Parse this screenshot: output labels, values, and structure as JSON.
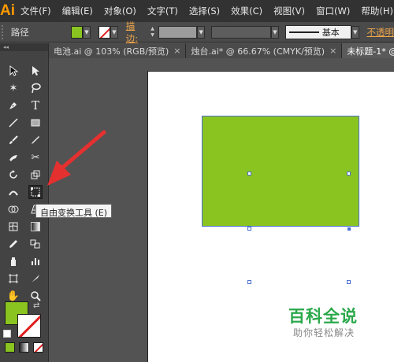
{
  "app": {
    "logo": "Ai"
  },
  "menu": [
    "文件(F)",
    "编辑(E)",
    "对象(O)",
    "文字(T)",
    "选择(S)",
    "效果(C)",
    "视图(V)",
    "窗口(W)",
    "帮助(H)"
  ],
  "control_bar": {
    "path_label": "路径",
    "fill_color": "#8ac420",
    "stroke_label": "描边:",
    "profile_label": "基本",
    "opacity_label": "不透明"
  },
  "tabs": [
    {
      "label": "电池.ai @ 103% (RGB/预览)",
      "close": "×",
      "active": false
    },
    {
      "label": "烛台.ai* @ 66.67% (CMYK/预览)",
      "close": "×",
      "active": false
    },
    {
      "label": "未标题-1* @ 9",
      "close": "",
      "active": true
    }
  ],
  "tooltip": {
    "text": "自由变换工具 (E)"
  },
  "tools": {
    "active": "free-transform-icon",
    "rows": [
      [
        "selection-arrow-icon",
        "direct-selection-icon"
      ],
      [
        "magic-wand-icon",
        "lasso-icon"
      ],
      [
        "pen-icon",
        "type-icon"
      ],
      [
        "line-segment-icon",
        "rectangle-icon"
      ],
      [
        "paintbrush-icon",
        "pencil-icon"
      ],
      [
        "blob-brush-icon",
        "scissors-icon"
      ],
      [
        "rotate-icon",
        "scale-icon"
      ],
      [
        "width-tool-icon",
        "free-transform-icon"
      ],
      [
        "shape-builder-icon",
        "perspective-grid-icon"
      ],
      [
        "mesh-icon",
        "gradient-icon"
      ],
      [
        "eyedropper-icon",
        "blend-icon"
      ],
      [
        "symbol-sprayer-icon",
        "column-graph-icon"
      ],
      [
        "artboard-icon",
        "slice-icon"
      ],
      [
        "hand-icon",
        "zoom-icon"
      ]
    ]
  },
  "colors": {
    "fill": "#8ac420",
    "stroke_none": "#e02020",
    "selection": "#4a6fd0",
    "accent": "#ff9a00"
  },
  "watermark": {
    "title": "百科全说",
    "subtitle": "助你轻松解决"
  }
}
